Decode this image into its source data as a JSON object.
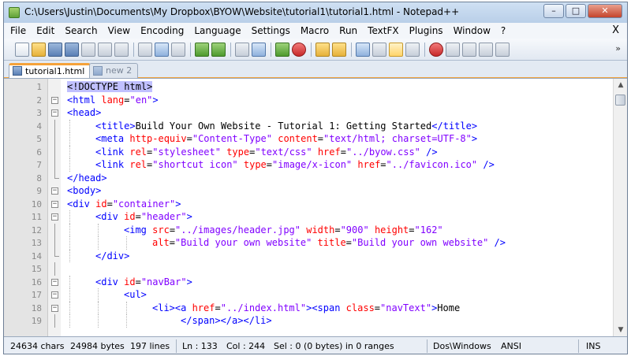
{
  "window": {
    "title": "C:\\Users\\Justin\\Documents\\My Dropbox\\BYOW\\Website\\tutorial1\\tutorial1.html - Notepad++",
    "minimize": "–",
    "maximize": "□",
    "close": "✕"
  },
  "menu": {
    "items": [
      "File",
      "Edit",
      "Search",
      "View",
      "Encoding",
      "Language",
      "Settings",
      "Macro",
      "Run",
      "TextFX",
      "Plugins",
      "Window",
      "?"
    ],
    "close_doc": "X"
  },
  "toolbar": {
    "more": "»",
    "icons": [
      "new-file-icon",
      "open-file-icon",
      "save-icon",
      "save-all-icon",
      "close-icon",
      "close-all-icon",
      "print-icon",
      "cut-icon",
      "copy-icon",
      "paste-icon",
      "undo-icon",
      "redo-icon",
      "find-icon",
      "replace-icon",
      "zoom-in-icon",
      "zoom-out-icon",
      "sync-vertical-icon",
      "sync-horizontal-icon",
      "word-wrap-icon",
      "show-all-chars-icon",
      "indent-guide-icon",
      "user-define-icon",
      "record-macro-icon",
      "stop-macro-icon",
      "play-macro-icon",
      "run-macro-multiple-icon",
      "save-macro-icon"
    ]
  },
  "tabs": [
    {
      "label": "tutorial1.html",
      "active": true
    },
    {
      "label": "new 2",
      "active": false
    }
  ],
  "editor": {
    "lines": [
      {
        "n": "1",
        "fold": "",
        "indent": 0,
        "tokens": [
          {
            "c": "hl",
            "v": "<!DOCTYPE html>"
          }
        ]
      },
      {
        "n": "2",
        "fold": "minus",
        "indent": 0,
        "tokens": [
          {
            "c": "t",
            "v": "<html "
          },
          {
            "c": "a",
            "v": "lang"
          },
          {
            "c": "x",
            "v": "="
          },
          {
            "c": "s",
            "v": "\"en\""
          },
          {
            "c": "t",
            "v": ">"
          }
        ]
      },
      {
        "n": "3",
        "fold": "minus",
        "indent": 0,
        "tokens": [
          {
            "c": "t",
            "v": "<head>"
          }
        ]
      },
      {
        "n": "4",
        "fold": "",
        "indent": 1,
        "tokens": [
          {
            "c": "t",
            "v": "<title>"
          },
          {
            "c": "x",
            "v": "Build Your Own Website - Tutorial 1: Getting Started"
          },
          {
            "c": "t",
            "v": "</title>"
          }
        ]
      },
      {
        "n": "5",
        "fold": "",
        "indent": 1,
        "tokens": [
          {
            "c": "t",
            "v": "<meta "
          },
          {
            "c": "a",
            "v": "http-equiv"
          },
          {
            "c": "x",
            "v": "="
          },
          {
            "c": "s",
            "v": "\"Content-Type\" "
          },
          {
            "c": "a",
            "v": "content"
          },
          {
            "c": "x",
            "v": "="
          },
          {
            "c": "s",
            "v": "\"text/html; charset=UTF-8\""
          },
          {
            "c": "t",
            "v": ">"
          }
        ]
      },
      {
        "n": "6",
        "fold": "",
        "indent": 1,
        "tokens": [
          {
            "c": "t",
            "v": "<link "
          },
          {
            "c": "a",
            "v": "rel"
          },
          {
            "c": "x",
            "v": "="
          },
          {
            "c": "s",
            "v": "\"stylesheet\" "
          },
          {
            "c": "a",
            "v": "type"
          },
          {
            "c": "x",
            "v": "="
          },
          {
            "c": "s",
            "v": "\"text/css\" "
          },
          {
            "c": "a",
            "v": "href"
          },
          {
            "c": "x",
            "v": "="
          },
          {
            "c": "s",
            "v": "\"../byow.css\" "
          },
          {
            "c": "t",
            "v": "/>"
          }
        ]
      },
      {
        "n": "7",
        "fold": "",
        "indent": 1,
        "tokens": [
          {
            "c": "t",
            "v": "<link "
          },
          {
            "c": "a",
            "v": "rel"
          },
          {
            "c": "x",
            "v": "="
          },
          {
            "c": "s",
            "v": "\"shortcut icon\" "
          },
          {
            "c": "a",
            "v": "type"
          },
          {
            "c": "x",
            "v": "="
          },
          {
            "c": "s",
            "v": "\"image/x-icon\" "
          },
          {
            "c": "a",
            "v": "href"
          },
          {
            "c": "x",
            "v": "="
          },
          {
            "c": "s",
            "v": "\"../favicon.ico\" "
          },
          {
            "c": "t",
            "v": "/>"
          }
        ]
      },
      {
        "n": "8",
        "fold": "end",
        "indent": 0,
        "tokens": [
          {
            "c": "t",
            "v": "</head>"
          }
        ]
      },
      {
        "n": "9",
        "fold": "minus",
        "indent": 0,
        "tokens": [
          {
            "c": "t",
            "v": "<body>"
          }
        ]
      },
      {
        "n": "10",
        "fold": "minus",
        "indent": 0,
        "tokens": [
          {
            "c": "t",
            "v": "<div "
          },
          {
            "c": "a",
            "v": "id"
          },
          {
            "c": "x",
            "v": "="
          },
          {
            "c": "s",
            "v": "\"container\""
          },
          {
            "c": "t",
            "v": ">"
          }
        ]
      },
      {
        "n": "11",
        "fold": "minus",
        "indent": 1,
        "tokens": [
          {
            "c": "t",
            "v": "<div "
          },
          {
            "c": "a",
            "v": "id"
          },
          {
            "c": "x",
            "v": "="
          },
          {
            "c": "s",
            "v": "\"header\""
          },
          {
            "c": "t",
            "v": ">"
          }
        ]
      },
      {
        "n": "12",
        "fold": "",
        "indent": 2,
        "tokens": [
          {
            "c": "t",
            "v": "<img "
          },
          {
            "c": "a",
            "v": "src"
          },
          {
            "c": "x",
            "v": "="
          },
          {
            "c": "s",
            "v": "\"../images/header.jpg\" "
          },
          {
            "c": "a",
            "v": "width"
          },
          {
            "c": "x",
            "v": "="
          },
          {
            "c": "s",
            "v": "\"900\" "
          },
          {
            "c": "a",
            "v": "height"
          },
          {
            "c": "x",
            "v": "="
          },
          {
            "c": "s",
            "v": "\"162\""
          }
        ]
      },
      {
        "n": "13",
        "fold": "",
        "indent": 3,
        "tokens": [
          {
            "c": "a",
            "v": "alt"
          },
          {
            "c": "x",
            "v": "="
          },
          {
            "c": "s",
            "v": "\"Build your own website\" "
          },
          {
            "c": "a",
            "v": "title"
          },
          {
            "c": "x",
            "v": "="
          },
          {
            "c": "s",
            "v": "\"Build your own website\" "
          },
          {
            "c": "t",
            "v": "/>"
          }
        ]
      },
      {
        "n": "14",
        "fold": "end",
        "indent": 1,
        "tokens": [
          {
            "c": "t",
            "v": "</div>"
          }
        ]
      },
      {
        "n": "15",
        "fold": "",
        "indent": 0,
        "tokens": []
      },
      {
        "n": "16",
        "fold": "minus",
        "indent": 1,
        "tokens": [
          {
            "c": "t",
            "v": "<div "
          },
          {
            "c": "a",
            "v": "id"
          },
          {
            "c": "x",
            "v": "="
          },
          {
            "c": "s",
            "v": "\"navBar\""
          },
          {
            "c": "t",
            "v": ">"
          }
        ]
      },
      {
        "n": "17",
        "fold": "minus",
        "indent": 2,
        "tokens": [
          {
            "c": "t",
            "v": "<ul>"
          }
        ]
      },
      {
        "n": "18",
        "fold": "minus",
        "indent": 3,
        "tokens": [
          {
            "c": "t",
            "v": "<li><a "
          },
          {
            "c": "a",
            "v": "href"
          },
          {
            "c": "x",
            "v": "="
          },
          {
            "c": "s",
            "v": "\"../index.html\""
          },
          {
            "c": "t",
            "v": "><span "
          },
          {
            "c": "a",
            "v": "class"
          },
          {
            "c": "x",
            "v": "="
          },
          {
            "c": "s",
            "v": "\"navText\""
          },
          {
            "c": "t",
            "v": ">"
          },
          {
            "c": "x",
            "v": "Home"
          }
        ]
      },
      {
        "n": "19",
        "fold": "",
        "indent": 4,
        "tokens": [
          {
            "c": "t",
            "v": "</span></a></li>"
          }
        ]
      }
    ]
  },
  "status": {
    "chars": "24634 chars",
    "bytes": "24984 bytes",
    "lines": "197 lines",
    "ln": "Ln : 133",
    "col": "Col : 244",
    "sel": "Sel : 0 (0 bytes) in 0 ranges",
    "eol": "Dos\\Windows",
    "encoding": "ANSI",
    "mode": "INS"
  }
}
